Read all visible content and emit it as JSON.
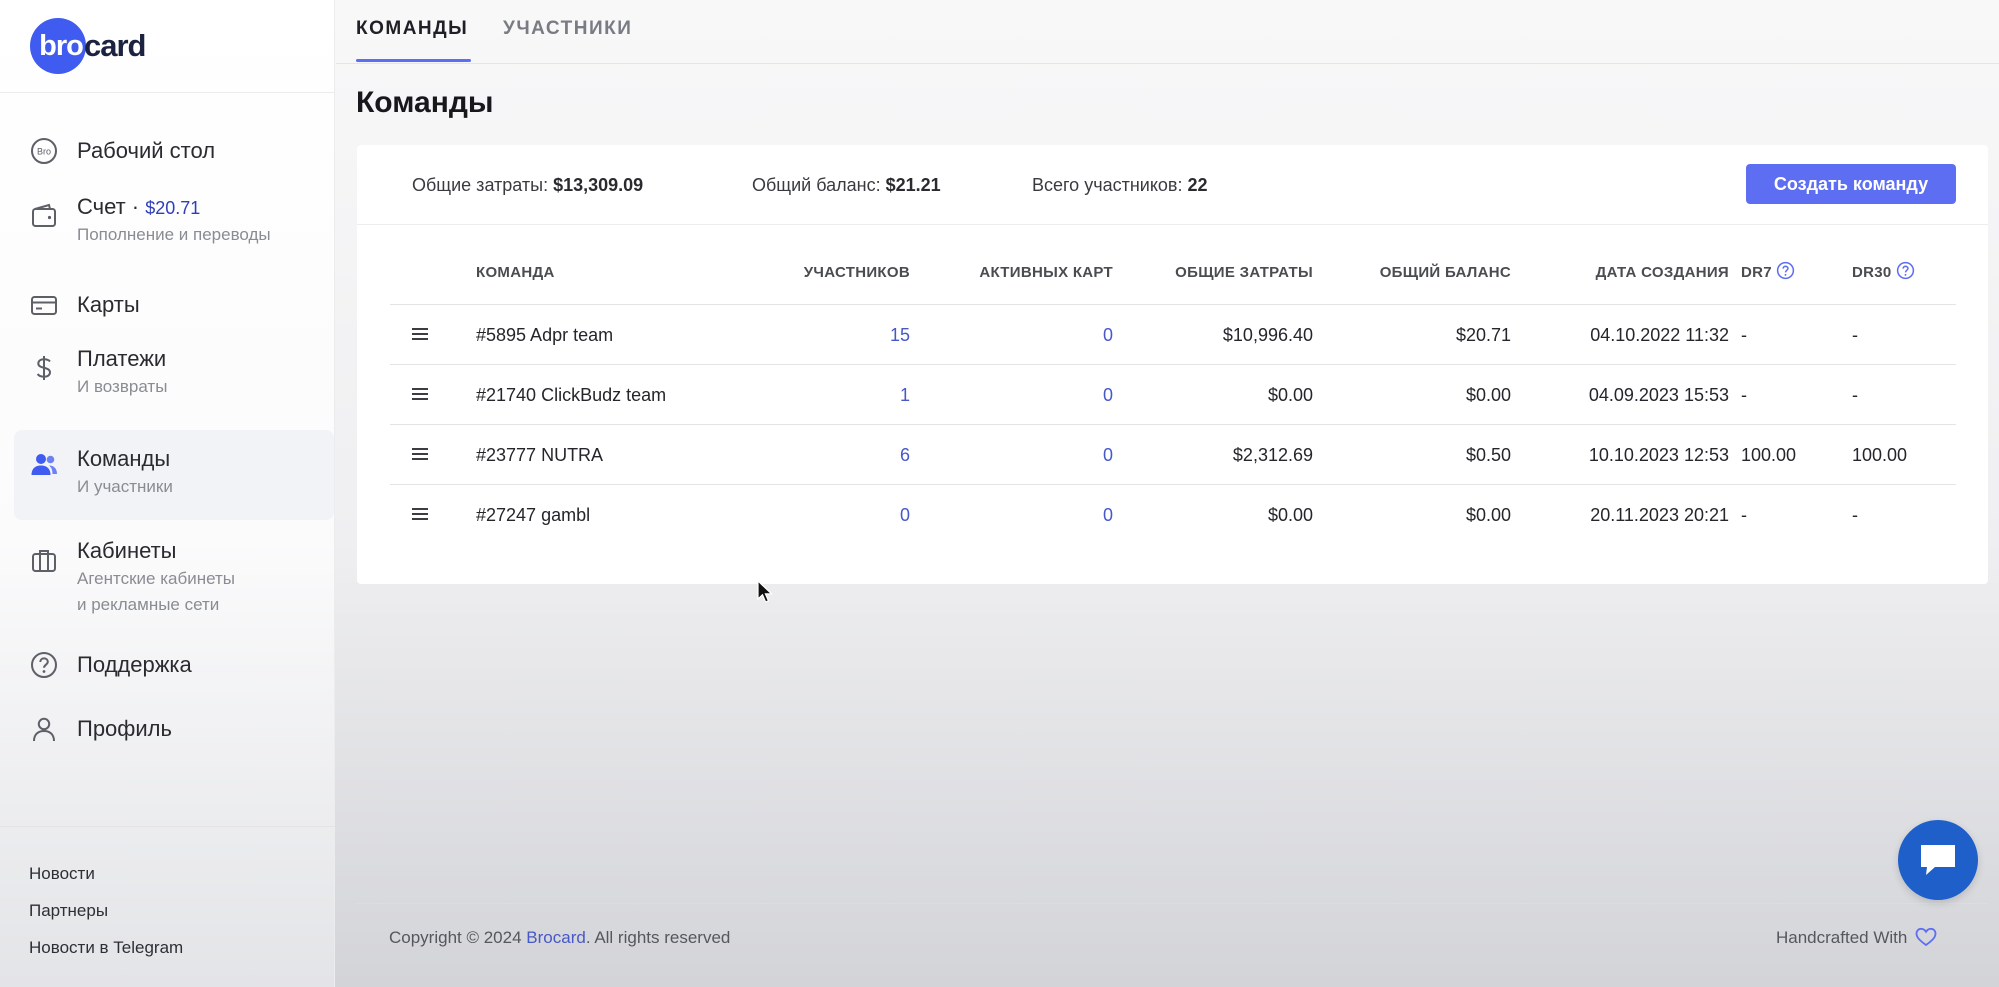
{
  "brand": {
    "logo_bro": "bro",
    "logo_card": "card",
    "accent": "#5e6ef3",
    "logo_color": "#3f5bf0"
  },
  "sidebar": {
    "items": [
      {
        "label": "Рабочий стол",
        "icon": "bro-circle-icon"
      },
      {
        "label": "Счет · ",
        "balance": "$20.71",
        "sub": "Пополнение и переводы",
        "icon": "wallet-icon"
      },
      {
        "label": "Карты",
        "icon": "card-icon"
      },
      {
        "label": "Платежи",
        "sub": "И возвраты",
        "icon": "dollar-icon"
      },
      {
        "label": "Команды",
        "sub": "И участники",
        "icon": "users-icon",
        "active": true
      },
      {
        "label": "Кабинеты",
        "sub1": "Агентские кабинеты",
        "sub2": "и рекламные сети",
        "icon": "briefcase-icon"
      },
      {
        "label": "Поддержка",
        "icon": "help-circle-icon"
      },
      {
        "label": "Профиль",
        "icon": "user-icon"
      }
    ],
    "bottom_links": [
      "Новости",
      "Партнеры",
      "Новости в Telegram"
    ]
  },
  "tabs": [
    {
      "label": "КОМАНДЫ",
      "active": true
    },
    {
      "label": "УЧАСТНИКИ",
      "active": false
    }
  ],
  "page_title": "Команды",
  "summary": {
    "spend_label": "Общие затраты: ",
    "spend_value": "$13,309.09",
    "balance_label": "Общий баланс: ",
    "balance_value": "$21.21",
    "members_label": "Всего участников: ",
    "members_value": "22",
    "create_button": "Создать команду"
  },
  "table": {
    "headers": {
      "team": "КОМАНДА",
      "members": "УЧАСТНИКОВ",
      "active_cards": "АКТИВНЫХ КАРТ",
      "total_spend": "ОБЩИЕ ЗАТРАТЫ",
      "total_balance": "ОБЩИЙ БАЛАНС",
      "created": "ДАТА СОЗДАНИЯ",
      "dr7": "DR7",
      "dr30": "DR30"
    },
    "rows": [
      {
        "team": "#5895 Adpr team",
        "members": "15",
        "active_cards": "0",
        "total_spend": "$10,996.40",
        "total_balance": "$20.71",
        "created": "04.10.2022 11:32",
        "dr7": "-",
        "dr30": "-"
      },
      {
        "team": "#21740 ClickBudz team",
        "members": "1",
        "active_cards": "0",
        "total_spend": "$0.00",
        "total_balance": "$0.00",
        "created": "04.09.2023 15:53",
        "dr7": "-",
        "dr30": "-"
      },
      {
        "team": "#23777 NUTRA",
        "members": "6",
        "active_cards": "0",
        "total_spend": "$2,312.69",
        "total_balance": "$0.50",
        "created": "10.10.2023 12:53",
        "dr7": "100.00",
        "dr30": "100.00"
      },
      {
        "team": "#27247 gambl",
        "members": "0",
        "active_cards": "0",
        "total_spend": "$0.00",
        "total_balance": "$0.00",
        "created": "20.11.2023 20:21",
        "dr7": "-",
        "dr30": "-"
      }
    ]
  },
  "footer": {
    "copyright_prefix": "Copyright © 2024 ",
    "copyright_brand": "Brocard",
    "copyright_suffix": ". All rights reserved",
    "handcrafted": "Handcrafted With"
  }
}
